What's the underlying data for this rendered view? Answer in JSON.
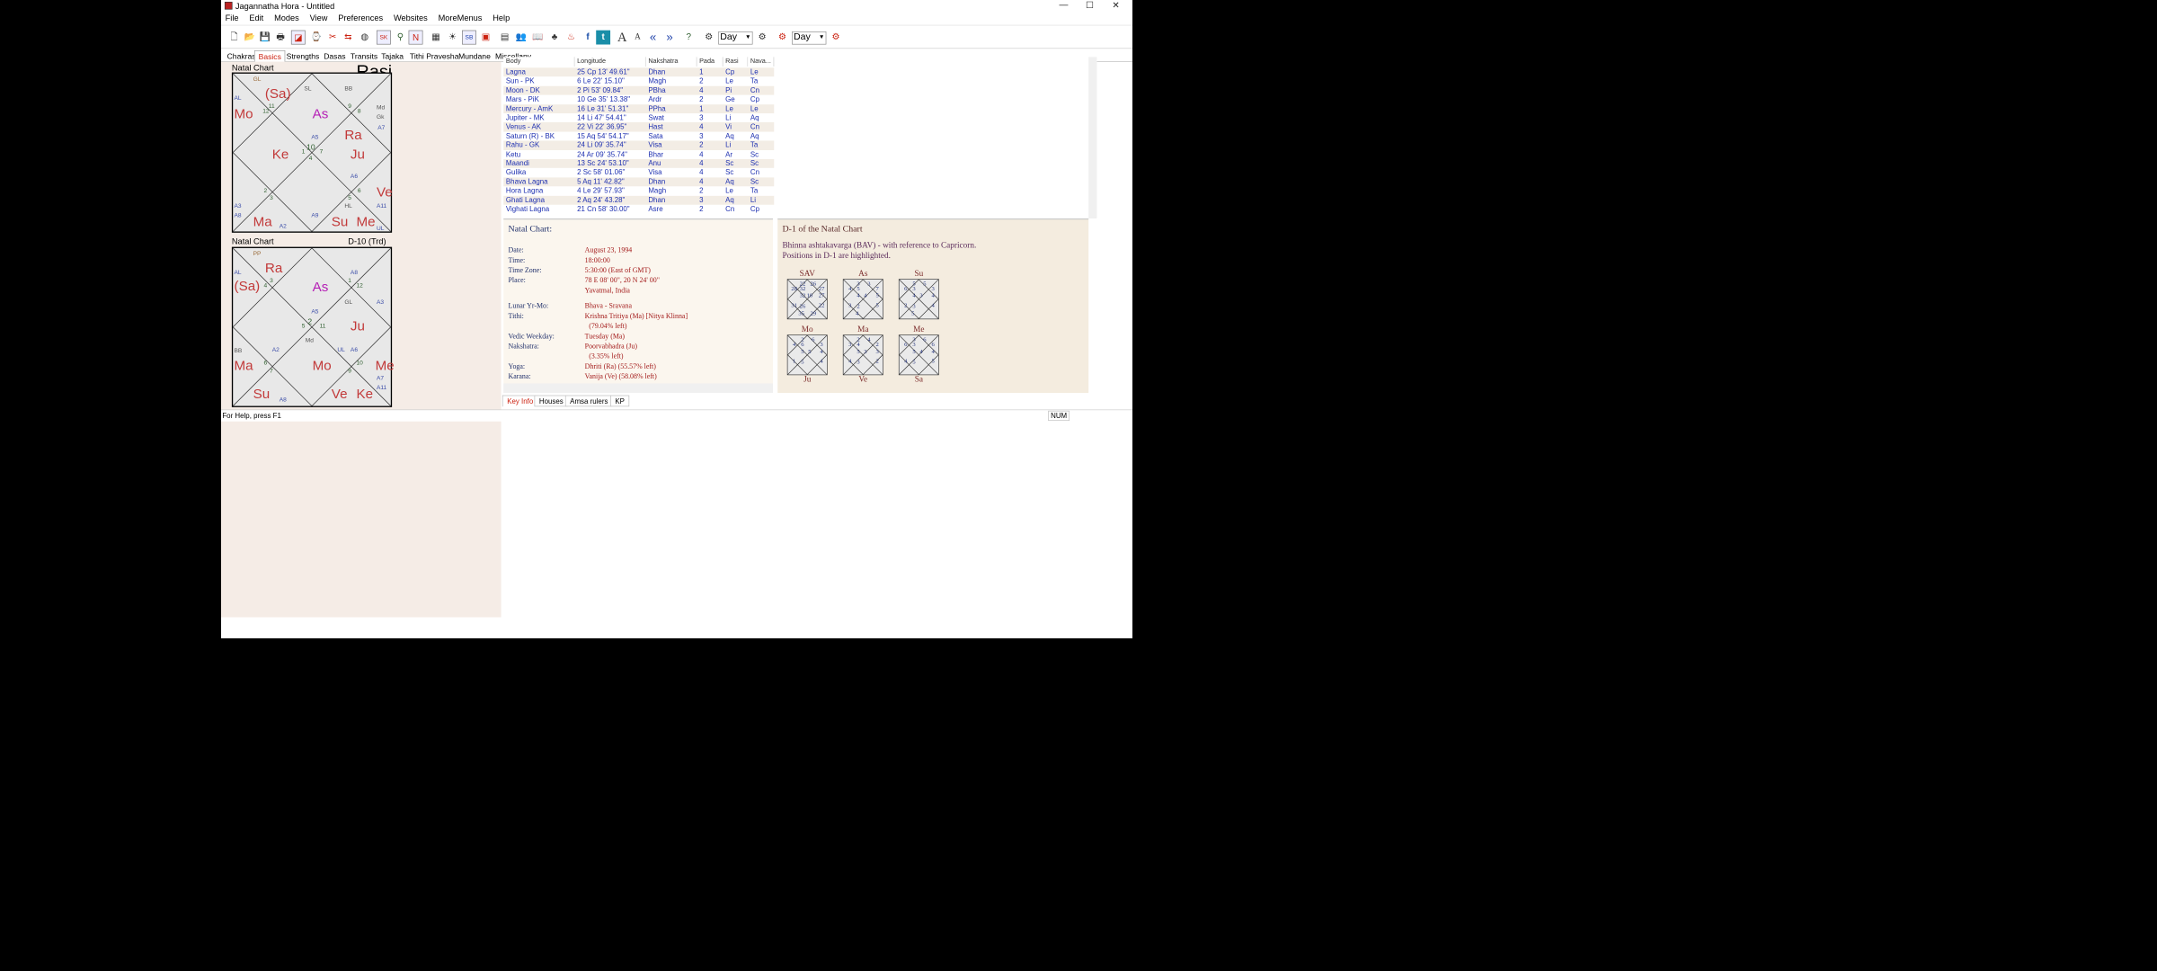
{
  "window": {
    "title": "Jagannatha Hora - Untitled",
    "controls": [
      "—",
      "☐",
      "✕"
    ]
  },
  "menu": [
    "File",
    "Edit",
    "Modes",
    "View",
    "Preferences",
    "Websites",
    "MoreMenus",
    "Help"
  ],
  "toolbar": {
    "select1": "Day",
    "select2": "Day",
    "icons": [
      "new-file-icon",
      "open-folder-icon",
      "save-icon",
      "print-icon",
      "chart-icon",
      "data-icon",
      "scissors-icon",
      "transfer-icon",
      "globe-icon",
      "sk-icon",
      "find-icon",
      "n-icon",
      "grid-icon",
      "sun-icon",
      "sb-icon",
      "square-icon",
      "table-icon",
      "people-icon",
      "book-icon",
      "tree-icon",
      "fire-icon",
      "facebook-icon",
      "twitter-icon",
      "font-large-icon",
      "font-small-icon",
      "prev-icon",
      "next-icon",
      "help-icon",
      "wheel-icon",
      "wheel-back-icon",
      "wheel-fwd-icon",
      "wheel-red-icon"
    ]
  },
  "tabs": [
    "Chakras",
    "Basics",
    "Strengths",
    "Dasas",
    "Transits",
    "Tajaka",
    "Tithi Pravesha",
    "Mundane",
    "Miscellany"
  ],
  "chart1": {
    "label": "Natal Chart",
    "varga": "Rasi"
  },
  "chart2": {
    "label": "Natal Chart",
    "varga": "D-10 (Trd)"
  },
  "chart1_text": {
    "gl": "GL",
    "sa": "(Sa)",
    "sl": "SL",
    "bb": "BB",
    "al": "AL",
    "mo": "Mo",
    "as": "As",
    "md": "Md",
    "gk": "Gk",
    "n12": "12",
    "n11": "11",
    "n9": "9",
    "n8": "8",
    "a7": "A7",
    "ra": "Ra",
    "ke": "Ke",
    "ju": "Ju",
    "a5": "A5",
    "n10": "10",
    "n1": "1",
    "n7": "7",
    "n4": "4",
    "a6": "A6",
    "n2": "2",
    "n3": "3",
    "n5": "5",
    "n6": "6",
    "ve": "Ve",
    "a3": "A3",
    "hl": "HL",
    "a11": "A11",
    "a8": "A8",
    "a9": "A9",
    "ma": "Ma",
    "su": "Su",
    "me": "Me",
    "a2": "A2",
    "ul": "UL"
  },
  "chart2_text": {
    "pp": "PP",
    "ra": "Ra",
    "al": "AL",
    "sa": "(Sa)",
    "as": "As",
    "a8": "A8",
    "n1": "1",
    "n12": "12",
    "n4": "4",
    "n3": "3",
    "a5": "A5",
    "gl": "GL",
    "a3": "A3",
    "n5": "5",
    "n2": "2",
    "n11": "11",
    "ju": "Ju",
    "md": "Md",
    "bb": "BB",
    "a2": "A2",
    "ul": "UL",
    "a6": "A6",
    "n6": "6",
    "n10": "10",
    "ma": "Ma",
    "mo": "Mo",
    "me": "Me",
    "n7": "7",
    "n9": "9",
    "a7": "A7",
    "a11": "A11",
    "su": "Su",
    "ve": "Ve",
    "ke": "Ke",
    "a8b": "A8"
  },
  "table": {
    "headers": [
      "Body",
      "Longitude",
      "Nakshatra",
      "Pada",
      "Rasi",
      "Nava..."
    ],
    "rows": [
      [
        "Lagna",
        "25 Cp 13' 49.61\"",
        "Dhan",
        "1",
        "Cp",
        "Le"
      ],
      [
        "Sun - PK",
        "6 Le 22' 15.10\"",
        "Magh",
        "2",
        "Le",
        "Ta"
      ],
      [
        "Moon - DK",
        "2 Pi 53' 09.84\"",
        "PBha",
        "4",
        "Pi",
        "Cn"
      ],
      [
        "Mars - PiK",
        "10 Ge 35' 13.38\"",
        "Ardr",
        "2",
        "Ge",
        "Cp"
      ],
      [
        "Mercury - AmK",
        "16 Le 31' 51.31\"",
        "PPha",
        "1",
        "Le",
        "Le"
      ],
      [
        "Jupiter - MK",
        "14 Li 47' 54.41\"",
        "Swat",
        "3",
        "Li",
        "Aq"
      ],
      [
        "Venus - AK",
        "22 Vi 22' 36.95\"",
        "Hast",
        "4",
        "Vi",
        "Cn"
      ],
      [
        "Saturn (R) - BK",
        "15 Aq 54' 54.17\"",
        "Sata",
        "3",
        "Aq",
        "Aq"
      ],
      [
        "Rahu - GK",
        "24 Li 09' 35.74\"",
        "Visa",
        "2",
        "Li",
        "Ta"
      ],
      [
        "Ketu",
        "24 Ar 09' 35.74\"",
        "Bhar",
        "4",
        "Ar",
        "Sc"
      ],
      [
        "Maandi",
        "13 Sc 24' 53.10\"",
        "Anu",
        "4",
        "Sc",
        "Sc"
      ],
      [
        "Gulika",
        "2 Sc 58' 01.06\"",
        "Visa",
        "4",
        "Sc",
        "Cn"
      ],
      [
        "Bhava Lagna",
        "5 Aq 11' 42.82\"",
        "Dhan",
        "4",
        "Aq",
        "Sc"
      ],
      [
        "Hora Lagna",
        "4 Le 29' 57.93\"",
        "Magh",
        "2",
        "Le",
        "Ta"
      ],
      [
        "Ghati Lagna",
        "2 Aq 24' 43.28\"",
        "Dhan",
        "3",
        "Aq",
        "Li"
      ],
      [
        "Vighati Lagna",
        "21 Cn 58' 30.00\"",
        "Asre",
        "2",
        "Cn",
        "Cp"
      ]
    ]
  },
  "keyinfo": {
    "heading": "Natal Chart:",
    "rows": [
      {
        "label": "Date:",
        "value": "August 23, 1994"
      },
      {
        "label": "Time:",
        "value": "18:00:00"
      },
      {
        "label": "Time Zone:",
        "value": "5:30:00 (East of GMT)"
      },
      {
        "label": "Place:",
        "value": "78 E 08' 00\", 20 N 24' 00\""
      },
      {
        "label": "",
        "value": "Yavatmal, India"
      },
      {
        "label": "Lunar Yr-Mo:",
        "value": "Bhava - Sravana"
      },
      {
        "label": "Tithi:",
        "value": "Krishna Tritiya (Ma) [Nitya Klinna]"
      },
      {
        "label": "",
        "value": "(79.04% left)"
      },
      {
        "label": "Vedic Weekday:",
        "value": "Tuesday (Ma)"
      },
      {
        "label": "Nakshatra:",
        "value": "Poorvabhadra (Ju)"
      },
      {
        "label": "",
        "value": "(3.35% left)"
      },
      {
        "label": "Yoga:",
        "value": "Dhriti (Ra) (55.57% left)"
      },
      {
        "label": "Karana:",
        "value": "Vanija (Ve) (58.08% left)"
      }
    ]
  },
  "bav": {
    "heading": "D-1 of the Natal Chart",
    "desc1": "Bhinna ashtakavarga (BAV) - with reference to Capricorn.",
    "desc2": "Positions in D-1 are highlighted.",
    "charts": [
      {
        "name": "SAV",
        "cells": [
          "22",
          "26",
          "28",
          "32",
          "27",
          "32",
          "10",
          "27",
          "31",
          "26",
          "22",
          "35",
          "29"
        ]
      },
      {
        "name": "As",
        "cells": [
          "3",
          "3",
          "4",
          "5",
          "7",
          "4",
          "4",
          "5",
          "3",
          "2",
          "5",
          "4"
        ]
      },
      {
        "name": "Su",
        "cells": [
          "5",
          "5",
          "6",
          "3",
          "3",
          "4",
          "3",
          "4",
          "2",
          "3",
          "4",
          "5"
        ]
      },
      {
        "name": "Mo",
        "cells": [
          "2",
          "6",
          "4",
          "6",
          "3",
          "5",
          "5",
          "4",
          "1",
          "5",
          "4"
        ]
      },
      {
        "name": "Ma",
        "cells": [
          "2",
          "4",
          "3",
          "4",
          "2",
          "5",
          "3",
          "3",
          "4",
          "3",
          "2"
        ]
      },
      {
        "name": "Me",
        "cells": [
          "3",
          "6",
          "6",
          "3",
          "6",
          "5",
          "4",
          "4",
          "4",
          "5",
          "5"
        ]
      }
    ],
    "more": [
      "Ju",
      "Ve",
      "Sa"
    ]
  },
  "bottomtabs": [
    "Key Info",
    "Houses",
    "Amsa rulers",
    "KP"
  ],
  "status": {
    "help": "For Help, press F1",
    "num": "NUM"
  }
}
